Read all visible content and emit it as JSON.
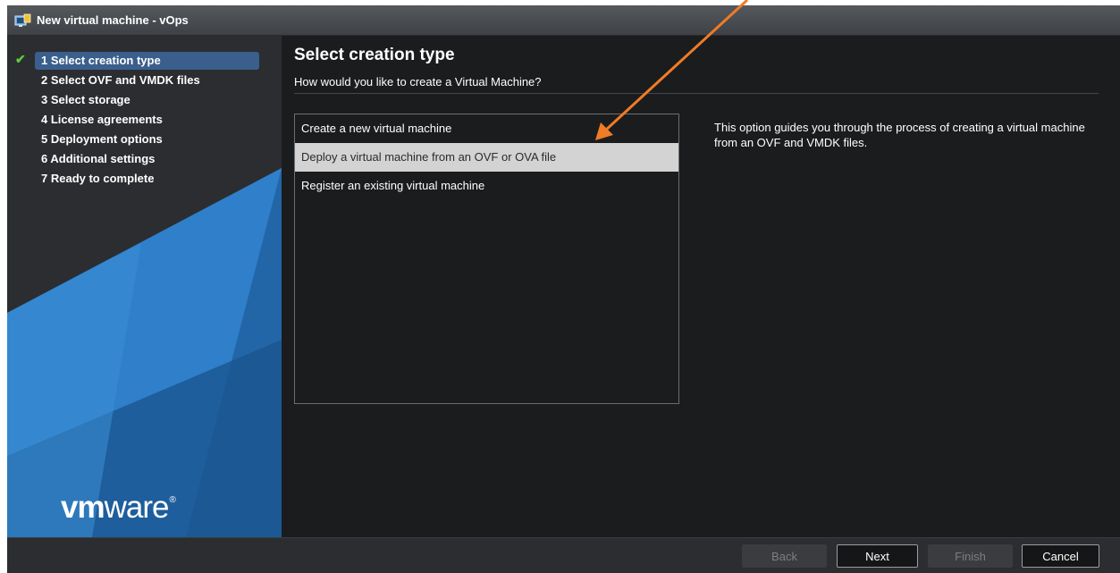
{
  "window": {
    "title": "New virtual machine - vOps",
    "icon": "vm-wizard-icon"
  },
  "sidebar": {
    "steps": [
      {
        "label": "1 Select creation type",
        "active": true,
        "completed": true
      },
      {
        "label": "2 Select OVF and VMDK files",
        "active": false
      },
      {
        "label": "3 Select storage",
        "active": false
      },
      {
        "label": "4 License agreements",
        "active": false
      },
      {
        "label": "5 Deployment options",
        "active": false
      },
      {
        "label": "6 Additional settings",
        "active": false
      },
      {
        "label": "7 Ready to complete",
        "active": false
      }
    ],
    "logo": {
      "bold": "vm",
      "rest": "ware",
      "mark": "®"
    },
    "check_icon": "checkmark-icon"
  },
  "main": {
    "title": "Select creation type",
    "subtitle": "How would you like to create a Virtual Machine?",
    "options": [
      {
        "label": "Create a new virtual machine",
        "selected": false
      },
      {
        "label": "Deploy a virtual machine from an OVF or OVA file",
        "selected": true
      },
      {
        "label": "Register an existing virtual machine",
        "selected": false
      }
    ],
    "description": "This option guides you through the process of creating a virtual machine from an OVF and VMDK files."
  },
  "footer": {
    "back": {
      "label": "Back",
      "enabled": false
    },
    "next": {
      "label": "Next",
      "enabled": true
    },
    "finish": {
      "label": "Finish",
      "enabled": false
    },
    "cancel": {
      "label": "Cancel",
      "enabled": true
    }
  },
  "annotation": {
    "arrow_color": "#f07c26"
  },
  "colors": {
    "active_step": "#3b5f8c",
    "selected_option": "#d3d3d3",
    "check": "#5ccb3c",
    "vmware_blue": "#2f7fca"
  }
}
